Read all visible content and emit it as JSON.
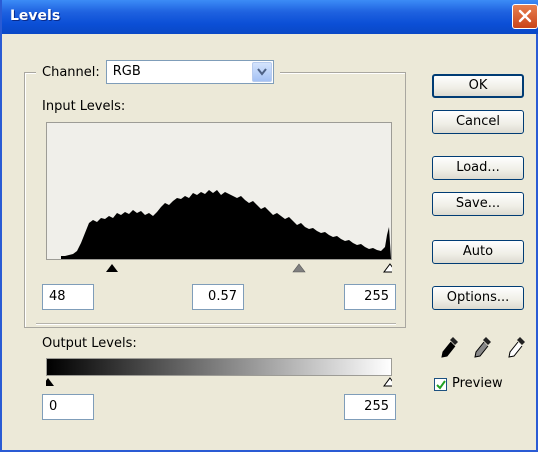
{
  "window": {
    "title": "Levels"
  },
  "channel": {
    "label": "Channel:",
    "value": "RGB"
  },
  "input_levels": {
    "label": "Input Levels:",
    "black": "48",
    "gamma": "0.57",
    "white": "255"
  },
  "output_levels": {
    "label": "Output Levels:",
    "black": "0",
    "white": "255"
  },
  "buttons": {
    "ok": "OK",
    "cancel": "Cancel",
    "load": "Load...",
    "save": "Save...",
    "auto": "Auto",
    "options": "Options..."
  },
  "preview": {
    "label": "Preview",
    "checked": true
  },
  "icons": {
    "close": "close-icon",
    "dropdown": "chevron-down-icon",
    "eyedroppers": [
      "black-eyedropper-icon",
      "gray-eyedropper-icon",
      "white-eyedropper-icon"
    ]
  }
}
